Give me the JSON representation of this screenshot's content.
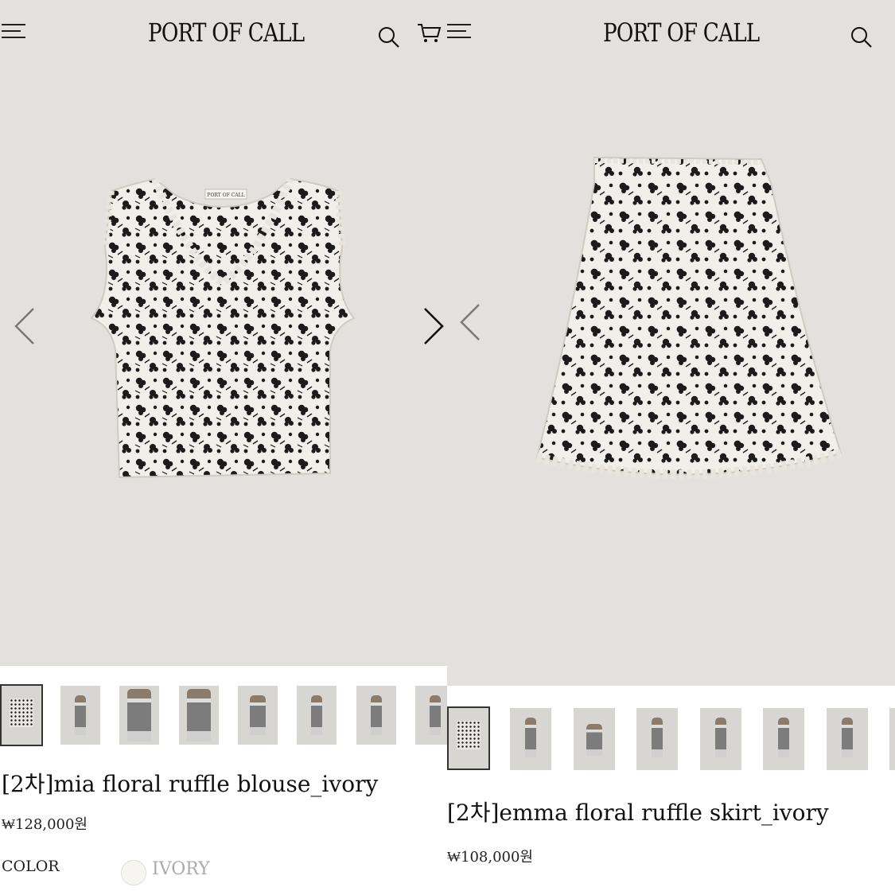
{
  "brand": "PORT OF CALL",
  "products": [
    {
      "title": "[2차]mia floral ruffle blouse_ivory",
      "price": "₩128,000원",
      "color_label": "COLOR",
      "color_value": "IVORY",
      "tag_text": "PORT OF CALL",
      "image_index": 1,
      "thumbnail_count": 8
    },
    {
      "title": "[2차]emma floral ruffle skirt_ivory",
      "price": "₩108,000원",
      "image_index": 1,
      "thumbnail_count": 8
    }
  ],
  "icons": [
    "hamburger-menu-icon",
    "search-icon",
    "cart-icon",
    "chevron-left-icon",
    "chevron-right-icon"
  ],
  "colors": {
    "hero_background": "#e3e1dd",
    "text": "#1a1a1a",
    "print_dark": "#1b1b1b",
    "print_light": "#f1efea"
  }
}
